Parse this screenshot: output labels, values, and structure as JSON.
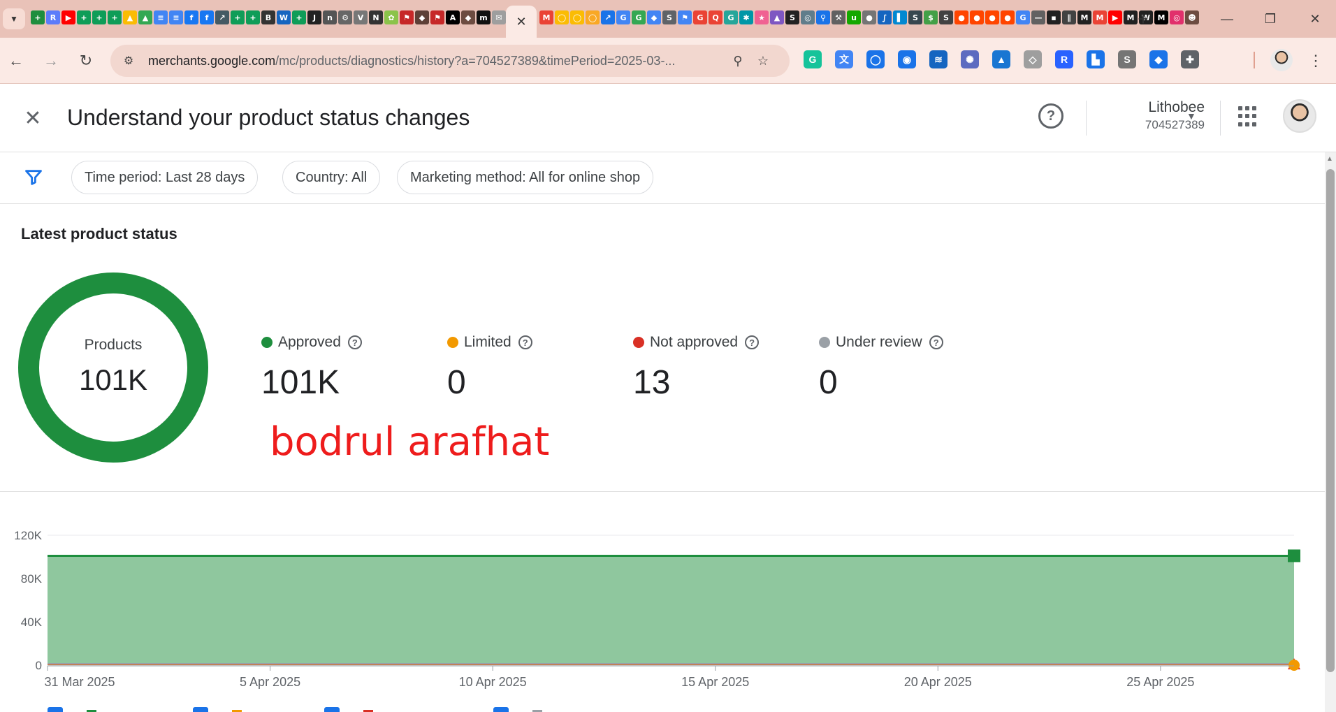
{
  "browser": {
    "tab_favicons_left": [
      {
        "icon": "green-app-icon",
        "color": "#1e8e3e",
        "text": "+"
      },
      {
        "icon": "r-icon",
        "color": "#5c7cfa",
        "text": "R"
      },
      {
        "icon": "youtube-icon",
        "color": "#ff0000",
        "text": "▶"
      },
      {
        "icon": "plus-app-icon",
        "color": "#0f9d58",
        "text": "+"
      },
      {
        "icon": "plus-app-icon",
        "color": "#0f9d58",
        "text": "+"
      },
      {
        "icon": "plus-app-icon",
        "color": "#0f9d58",
        "text": "+"
      },
      {
        "icon": "drive-icon",
        "color": "#fbbc04",
        "text": "▲"
      },
      {
        "icon": "drive-icon",
        "color": "#34a853",
        "text": "▲"
      },
      {
        "icon": "docs-icon",
        "color": "#4285f4",
        "text": "≡"
      },
      {
        "icon": "docs-icon",
        "color": "#4285f4",
        "text": "≡"
      },
      {
        "icon": "facebook-icon",
        "color": "#1877f2",
        "text": "f"
      },
      {
        "icon": "facebook-icon",
        "color": "#1877f2",
        "text": "f"
      },
      {
        "icon": "chart-app-icon",
        "color": "#2e7d32",
        "text": "A"
      }
    ],
    "tab_favicons_mid": [
      {
        "icon": "chart-app-icon",
        "color": "#455a64",
        "text": "↗"
      },
      {
        "icon": "plus-app-icon",
        "color": "#0f9d58",
        "text": "+"
      },
      {
        "icon": "plus-app-icon",
        "color": "#0f9d58",
        "text": "+"
      },
      {
        "icon": "b-icon",
        "color": "#333333",
        "text": "B"
      },
      {
        "icon": "w-icon",
        "color": "#1565c0",
        "text": "W"
      },
      {
        "icon": "plus-app-icon",
        "color": "#0f9d58",
        "text": "+"
      },
      {
        "icon": "jm-icon",
        "color": "#222222",
        "text": "J"
      },
      {
        "icon": "news-icon",
        "color": "#555555",
        "text": "n"
      },
      {
        "icon": "gear-app-icon",
        "color": "#666666",
        "text": "⚙"
      },
      {
        "icon": "news-icon",
        "color": "#777777",
        "text": "V"
      },
      {
        "icon": "na-icon",
        "color": "#333333",
        "text": "N"
      },
      {
        "icon": "leaf-icon",
        "color": "#8bc34a",
        "text": "✿"
      },
      {
        "icon": "flag-icon",
        "color": "#c62828",
        "text": "⚑"
      },
      {
        "icon": "shield-app-icon",
        "color": "#5d4037",
        "text": "◆"
      },
      {
        "icon": "flag-icon",
        "color": "#c62828",
        "text": "⚑"
      },
      {
        "icon": "a-icon",
        "color": "#000000",
        "text": "A"
      },
      {
        "icon": "shield-app-icon",
        "color": "#6d4c41",
        "text": "◆"
      },
      {
        "icon": "m-icon",
        "color": "#111111",
        "text": "m"
      },
      {
        "icon": "mail-icon",
        "color": "#9e9e9e",
        "text": "✉"
      },
      {
        "icon": "google-icon",
        "color": "#4285f4",
        "text": "G"
      }
    ],
    "active_tab_close": "✕",
    "tab_favicons_right": [
      {
        "icon": "gmail-icon",
        "color": "#ea4335",
        "text": "M"
      },
      {
        "icon": "circle-app-icon",
        "color": "#fbbc04",
        "text": "◯"
      },
      {
        "icon": "circle-app-icon",
        "color": "#fbbc04",
        "text": "◯"
      },
      {
        "icon": "circle-app-icon",
        "color": "#f9a825",
        "text": "◯"
      },
      {
        "icon": "analytics-icon",
        "color": "#1a73e8",
        "text": "↗"
      },
      {
        "icon": "google-icon",
        "color": "#4285f4",
        "text": "G"
      },
      {
        "icon": "google-icon",
        "color": "#34a853",
        "text": "G"
      },
      {
        "icon": "ads-icon",
        "color": "#4285f4",
        "text": "◆"
      },
      {
        "icon": "search-console-icon",
        "color": "#5f6368",
        "text": "S"
      },
      {
        "icon": "flag-icon",
        "color": "#4285f4",
        "text": "⚑"
      },
      {
        "icon": "google-icon",
        "color": "#ea4335",
        "text": "G"
      },
      {
        "icon": "search-icon",
        "color": "#ea4335",
        "text": "Q"
      },
      {
        "icon": "gif-icon",
        "color": "#26a69a",
        "text": "G"
      },
      {
        "icon": "gear-app-icon",
        "color": "#0097a7",
        "text": "✱"
      },
      {
        "icon": "star-app-icon",
        "color": "#f06292",
        "text": "★"
      },
      {
        "icon": "boomerang-icon",
        "color": "#7e57c2",
        "text": "▲"
      },
      {
        "icon": "s-icon",
        "color": "#222222",
        "text": "S"
      },
      {
        "icon": "globe-icon",
        "color": "#607d8b",
        "text": "◎"
      },
      {
        "icon": "search-icon",
        "color": "#1a73e8",
        "text": "⚲"
      },
      {
        "icon": "tool-icon",
        "color": "#616161",
        "text": "⚒"
      },
      {
        "icon": "upwork-icon",
        "color": "#14a800",
        "text": "u"
      },
      {
        "icon": "record-icon",
        "color": "#757575",
        "text": "●"
      },
      {
        "icon": "wave-icon",
        "color": "#1565c0",
        "text": "∫"
      },
      {
        "icon": "bar-icon",
        "color": "#0288d1",
        "text": "▌"
      },
      {
        "icon": "sg-icon",
        "color": "#37474f",
        "text": "S"
      },
      {
        "icon": "dollar-icon",
        "color": "#43a047",
        "text": "$"
      },
      {
        "icon": "s-icon",
        "color": "#424242",
        "text": "S"
      },
      {
        "icon": "reddit-icon",
        "color": "#ff4500",
        "text": "●"
      },
      {
        "icon": "reddit-icon",
        "color": "#ff4500",
        "text": "●"
      },
      {
        "icon": "reddit-icon",
        "color": "#ff4500",
        "text": "●"
      },
      {
        "icon": "reddit-icon",
        "color": "#ff4500",
        "text": "●"
      },
      {
        "icon": "google-icon",
        "color": "#4285f4",
        "text": "G"
      },
      {
        "icon": "line-icon",
        "color": "#616161",
        "text": "—"
      },
      {
        "icon": "ad-icon",
        "color": "#212121",
        "text": "▪"
      },
      {
        "icon": "tally-icon",
        "color": "#424242",
        "text": "∥"
      },
      {
        "icon": "mm-icon",
        "color": "#212121",
        "text": "M"
      },
      {
        "icon": "gmail-icon",
        "color": "#ea4335",
        "text": "M"
      },
      {
        "icon": "youtube-icon",
        "color": "#ff0000",
        "text": "▶"
      },
      {
        "icon": "mm-icon",
        "color": "#212121",
        "text": "M"
      },
      {
        "icon": "wsj-icon",
        "color": "#212121",
        "text": "W"
      },
      {
        "icon": "m-icon",
        "color": "#000000",
        "text": "M"
      },
      {
        "icon": "instagram-icon",
        "color": "#e1306c",
        "text": "◎"
      },
      {
        "icon": "people-icon",
        "color": "#6d4c41",
        "text": "☻"
      }
    ],
    "new_tab": "+",
    "window_controls": {
      "minimize": "—",
      "restore": "❐",
      "close": "✕"
    },
    "url": "merchants.google.com",
    "url_path": "/mc/products/diagnostics/history?a=704527389&timePeriod=2025-03-...",
    "extensions": [
      {
        "icon": "grammarly-icon",
        "color": "#15c39a",
        "text": "G"
      },
      {
        "icon": "translate-icon",
        "color": "#4285f4",
        "text": "文"
      },
      {
        "icon": "circle-ext-icon",
        "color": "#1a73e8",
        "text": "◯"
      },
      {
        "icon": "eye-ext-icon",
        "color": "#1a73e8",
        "text": "◉"
      },
      {
        "icon": "layers-ext-icon",
        "color": "#1565c0",
        "text": "≋"
      },
      {
        "icon": "snowflake-ext-icon",
        "color": "#5c6bc0",
        "text": "✺"
      },
      {
        "icon": "mountain-ext-icon",
        "color": "#1976d2",
        "text": "▲"
      },
      {
        "icon": "tag-ext-icon",
        "color": "#9e9e9e",
        "text": "◇"
      },
      {
        "icon": "r-ext-icon",
        "color": "#2962ff",
        "text": "R"
      },
      {
        "icon": "blocks-ext-icon",
        "color": "#1a73e8",
        "text": "▙"
      },
      {
        "icon": "seo-ext-icon",
        "color": "#757575",
        "text": "S"
      },
      {
        "icon": "tag-ext-icon",
        "color": "#1a73e8",
        "text": "◆"
      },
      {
        "icon": "puzzle-icon",
        "color": "#5f6368",
        "text": "✚"
      }
    ]
  },
  "header": {
    "title": "Understand your product status changes",
    "account_name": "Lithobee",
    "account_id": "704527389"
  },
  "filters": [
    {
      "label": "Time period: Last 28 days"
    },
    {
      "label": "Country: All"
    },
    {
      "label": "Marketing method: All for online shop"
    }
  ],
  "status": {
    "section_title": "Latest product status",
    "donut_label": "Products",
    "donut_value": "101K",
    "items": [
      {
        "label": "Approved",
        "value": "101K",
        "color": "#1e8e3e"
      },
      {
        "label": "Limited",
        "value": "0",
        "color": "#f29900"
      },
      {
        "label": "Not approved",
        "value": "13",
        "color": "#d93025"
      },
      {
        "label": "Under review",
        "value": "0",
        "color": "#9aa0a6"
      }
    ]
  },
  "watermark": "bodrul arafhat",
  "chart_data": {
    "type": "area",
    "x": [
      "2025-03-31",
      "2025-04-28"
    ],
    "x_tick_labels": [
      "31 Mar 2025",
      "5 Apr 2025",
      "10 Apr 2025",
      "15 Apr 2025",
      "20 Apr 2025",
      "25 Apr 2025"
    ],
    "x_tick_dates": [
      "2025-03-31",
      "2025-04-05",
      "2025-04-10",
      "2025-04-15",
      "2025-04-20",
      "2025-04-25"
    ],
    "y_tick_labels": [
      "0",
      "40K",
      "80K",
      "120K"
    ],
    "ylim": [
      0,
      120000
    ],
    "grid": true,
    "series": [
      {
        "name": "Approved",
        "color": "#1e8e3e",
        "fill": "#8fc79e",
        "values": [
          101000,
          101000
        ]
      },
      {
        "name": "Limited",
        "color": "#f29900",
        "values": [
          0,
          0
        ]
      },
      {
        "name": "Not approved",
        "color": "#d93025",
        "values": [
          13,
          13
        ]
      },
      {
        "name": "Under review",
        "color": "#9aa0a6",
        "values": [
          0,
          0
        ]
      }
    ]
  }
}
